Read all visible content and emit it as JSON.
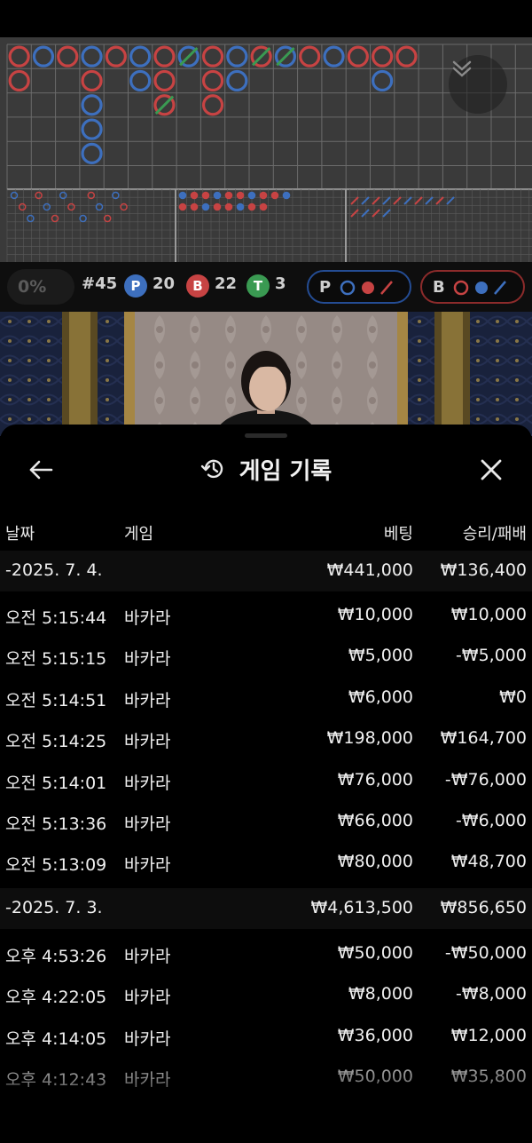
{
  "stats": {
    "percent": "0%",
    "round": "#45",
    "player_letter": "P",
    "player_count": "20",
    "banker_letter": "B",
    "banker_count": "22",
    "tie_letter": "T",
    "tie_count": "3"
  },
  "predict": {
    "player_label": "P",
    "banker_label": "B"
  },
  "icons": {
    "collapse": "chevron-double-down-icon",
    "back": "arrow-left-icon",
    "history": "history-icon",
    "close": "close-icon"
  },
  "colors": {
    "player": "#3d6fbe",
    "banker": "#c74343",
    "tie": "#3a9a52",
    "roadmap_bg": "#3a3a3a"
  },
  "history": {
    "title": "게임 기록",
    "columns": {
      "date": "날짜",
      "game": "게임",
      "bet": "베팅",
      "winloss": "승리/패배"
    },
    "rows": [
      {
        "type": "date",
        "date": "-2025. 7. 4.",
        "bet": "₩441,000",
        "result": "₩136,400"
      },
      {
        "type": "item",
        "time": "오전 5:15:44",
        "game": "바카라",
        "bet": "₩10,000",
        "result": "₩10,000"
      },
      {
        "type": "item",
        "time": "오전 5:15:15",
        "game": "바카라",
        "bet": "₩5,000",
        "result": "-₩5,000"
      },
      {
        "type": "item",
        "time": "오전 5:14:51",
        "game": "바카라",
        "bet": "₩6,000",
        "result": "₩0"
      },
      {
        "type": "item",
        "time": "오전 5:14:25",
        "game": "바카라",
        "bet": "₩198,000",
        "result": "₩164,700"
      },
      {
        "type": "item",
        "time": "오전 5:14:01",
        "game": "바카라",
        "bet": "₩76,000",
        "result": "-₩76,000"
      },
      {
        "type": "item",
        "time": "오전 5:13:36",
        "game": "바카라",
        "bet": "₩66,000",
        "result": "-₩6,000"
      },
      {
        "type": "item",
        "time": "오전 5:13:09",
        "game": "바카라",
        "bet": "₩80,000",
        "result": "₩48,700"
      },
      {
        "type": "date",
        "date": "-2025. 7. 3.",
        "bet": "₩4,613,500",
        "result": "₩856,650"
      },
      {
        "type": "item",
        "time": "오후 4:53:26",
        "game": "바카라",
        "bet": "₩50,000",
        "result": "-₩50,000"
      },
      {
        "type": "item",
        "time": "오후 4:22:05",
        "game": "바카라",
        "bet": "₩8,000",
        "result": "-₩8,000"
      },
      {
        "type": "item",
        "time": "오후 4:14:05",
        "game": "바카라",
        "bet": "₩36,000",
        "result": "₩12,000"
      },
      {
        "type": "item",
        "time": "오후 4:12:43",
        "game": "바카라",
        "bet": "₩50,000",
        "result": "₩35,800"
      }
    ]
  }
}
